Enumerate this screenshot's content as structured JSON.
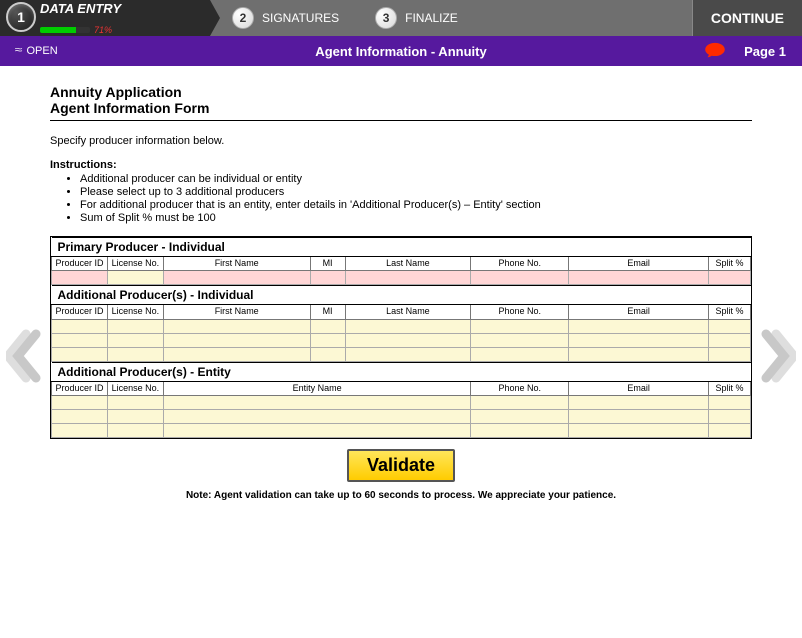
{
  "stepper": {
    "steps": [
      {
        "num": "1",
        "label": "DATA ENTRY",
        "progress_pct": 71,
        "progress_text": "71%"
      },
      {
        "num": "2",
        "label": "SIGNATURES"
      },
      {
        "num": "3",
        "label": "FINALIZE"
      }
    ],
    "continue": "CONTINUE"
  },
  "subheader": {
    "open_label": "OPEN",
    "title": "Agent Information - Annuity",
    "page": "Page 1"
  },
  "form": {
    "title_line1": "Annuity Application",
    "title_line2": "Agent Information Form",
    "intro": "Specify producer information below.",
    "instructions_head": "Instructions:",
    "instructions": [
      "Additional producer can be individual or entity",
      "Please select up to 3 additional producers",
      "For additional producer that is an entity, enter details in 'Additional Producer(s) – Entity' section",
      "Sum of Split % must be 100"
    ],
    "sections": {
      "primary": {
        "title": "Primary Producer - Individual",
        "columns": [
          "Producer ID",
          "License No.",
          "First Name",
          "MI",
          "Last Name",
          "Phone No.",
          "Email",
          "Split %"
        ],
        "rows": [
          {
            "style": "pink-yellow",
            "cells": [
              "",
              "",
              "",
              "",
              "",
              "",
              "",
              ""
            ]
          }
        ]
      },
      "additional_individual": {
        "title": "Additional Producer(s) - Individual",
        "columns": [
          "Producer ID",
          "License No.",
          "First Name",
          "MI",
          "Last Name",
          "Phone No.",
          "Email",
          "Split %"
        ],
        "rows": [
          {
            "style": "yellow",
            "cells": [
              "",
              "",
              "",
              "",
              "",
              "",
              "",
              ""
            ]
          },
          {
            "style": "yellow",
            "cells": [
              "",
              "",
              "",
              "",
              "",
              "",
              "",
              ""
            ]
          },
          {
            "style": "yellow",
            "cells": [
              "",
              "",
              "",
              "",
              "",
              "",
              "",
              ""
            ]
          }
        ]
      },
      "additional_entity": {
        "title": "Additional Producer(s) - Entity",
        "columns": [
          "Producer ID",
          "License No.",
          "Entity Name",
          "Phone No.",
          "Email",
          "Split %"
        ],
        "rows": [
          {
            "style": "yellow",
            "cells": [
              "",
              "",
              "",
              "",
              "",
              ""
            ]
          },
          {
            "style": "yellow",
            "cells": [
              "",
              "",
              "",
              "",
              "",
              ""
            ]
          },
          {
            "style": "yellow",
            "cells": [
              "",
              "",
              "",
              "",
              "",
              ""
            ]
          }
        ]
      }
    },
    "validate_label": "Validate",
    "note": "Note: Agent validation can take up to 60 seconds to process. We appreciate your patience."
  }
}
